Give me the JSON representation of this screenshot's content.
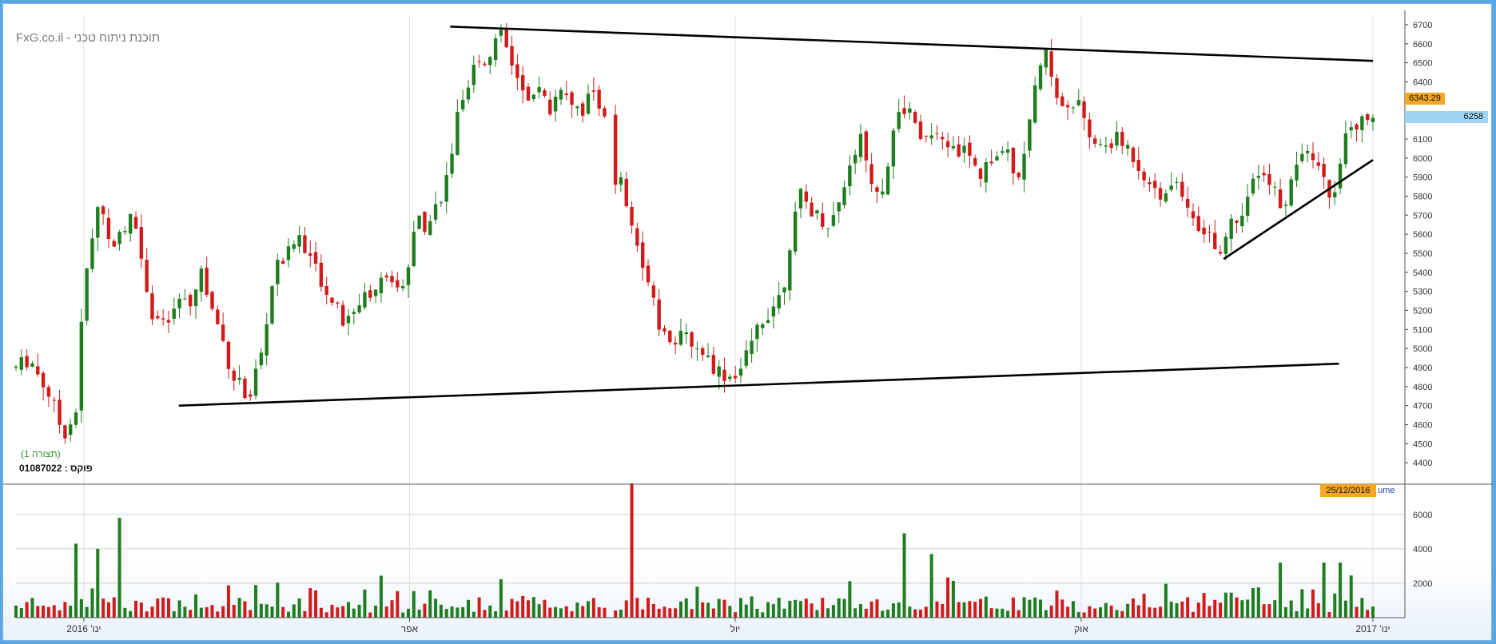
{
  "watermark": "FxG.co.il - תוכנת ניתוח טכני",
  "chart_caption": "(תצורה 1)",
  "focus_label": "פוקס : 01087022",
  "last_price_label": "6343.29",
  "current_price_label": "6258",
  "date_label": "25/12/2016",
  "volume_title": "ume",
  "colors": {
    "up": "#1e7d1e",
    "down": "#d21a1a",
    "grid": "#cfcfcf",
    "trendline": "#000000",
    "last_price_bg": "#f5a623",
    "current_price_bg": "#9fd4f5",
    "caption": "#2e8b2e"
  },
  "chart_data": [
    {
      "type": "candlestick",
      "title": "",
      "y_ticks": [
        4400,
        4500,
        4600,
        4700,
        4800,
        4900,
        5000,
        5100,
        5200,
        5300,
        5400,
        5500,
        5600,
        5700,
        5800,
        5900,
        6000,
        6100,
        6200,
        6300,
        6400,
        6500,
        6600,
        6700
      ],
      "ylim": [
        4300,
        6750
      ],
      "x_ticks": [
        "ינו' 2016",
        "אפר",
        "יול",
        "אוק",
        "ינו' 2017"
      ],
      "x_tick_positions": [
        0.05,
        0.29,
        0.53,
        0.785,
        1.0
      ],
      "trendlines": [
        {
          "name": "upper-resistance",
          "from": [
            0.32,
            6690
          ],
          "to": [
            1.0,
            6510
          ]
        },
        {
          "name": "lower-support",
          "from": [
            0.12,
            4700
          ],
          "to": [
            0.975,
            4920
          ]
        },
        {
          "name": "rising-support",
          "from": [
            0.89,
            5470
          ],
          "to": [
            1.0,
            5990
          ]
        }
      ],
      "anchors": [
        [
          0.0,
          4900
        ],
        [
          0.01,
          4950
        ],
        [
          0.025,
          4750
        ],
        [
          0.035,
          4550
        ],
        [
          0.045,
          4680
        ],
        [
          0.05,
          5350
        ],
        [
          0.055,
          5500
        ],
        [
          0.06,
          5750
        ],
        [
          0.065,
          5700
        ],
        [
          0.072,
          5500
        ],
        [
          0.08,
          5650
        ],
        [
          0.085,
          5750
        ],
        [
          0.092,
          5500
        ],
        [
          0.1,
          5200
        ],
        [
          0.11,
          5100
        ],
        [
          0.12,
          5250
        ],
        [
          0.13,
          5200
        ],
        [
          0.135,
          5450
        ],
        [
          0.142,
          5250
        ],
        [
          0.15,
          5100
        ],
        [
          0.16,
          4850
        ],
        [
          0.172,
          4750
        ],
        [
          0.182,
          5000
        ],
        [
          0.19,
          5400
        ],
        [
          0.2,
          5500
        ],
        [
          0.21,
          5600
        ],
        [
          0.218,
          5450
        ],
        [
          0.23,
          5300
        ],
        [
          0.24,
          5150
        ],
        [
          0.25,
          5200
        ],
        [
          0.26,
          5300
        ],
        [
          0.27,
          5350
        ],
        [
          0.28,
          5300
        ],
        [
          0.288,
          5400
        ],
        [
          0.295,
          5700
        ],
        [
          0.302,
          5650
        ],
        [
          0.31,
          5750
        ],
        [
          0.318,
          5900
        ],
        [
          0.325,
          6200
        ],
        [
          0.332,
          6300
        ],
        [
          0.34,
          6550
        ],
        [
          0.347,
          6500
        ],
        [
          0.355,
          6650
        ],
        [
          0.362,
          6600
        ],
        [
          0.37,
          6400
        ],
        [
          0.378,
          6250
        ],
        [
          0.386,
          6350
        ],
        [
          0.394,
          6250
        ],
        [
          0.402,
          6400
        ],
        [
          0.41,
          6300
        ],
        [
          0.418,
          6250
        ],
        [
          0.424,
          6350
        ],
        [
          0.43,
          6300
        ],
        [
          0.436,
          6200
        ],
        [
          0.44,
          5800
        ],
        [
          0.445,
          5900
        ],
        [
          0.452,
          5650
        ],
        [
          0.46,
          5500
        ],
        [
          0.468,
          5350
        ],
        [
          0.475,
          5100
        ],
        [
          0.485,
          5050
        ],
        [
          0.495,
          5050
        ],
        [
          0.505,
          5000
        ],
        [
          0.515,
          4900
        ],
        [
          0.525,
          4850
        ],
        [
          0.535,
          4900
        ],
        [
          0.545,
          5100
        ],
        [
          0.555,
          5200
        ],
        [
          0.565,
          5300
        ],
        [
          0.57,
          5550
        ],
        [
          0.578,
          5800
        ],
        [
          0.59,
          5700
        ],
        [
          0.6,
          5650
        ],
        [
          0.608,
          5800
        ],
        [
          0.615,
          6000
        ],
        [
          0.622,
          6100
        ],
        [
          0.63,
          5900
        ],
        [
          0.638,
          5800
        ],
        [
          0.648,
          6200
        ],
        [
          0.658,
          6250
        ],
        [
          0.665,
          6100
        ],
        [
          0.675,
          6100
        ],
        [
          0.69,
          6050
        ],
        [
          0.7,
          6050
        ],
        [
          0.71,
          5900
        ],
        [
          0.72,
          6000
        ],
        [
          0.73,
          6050
        ],
        [
          0.738,
          5900
        ],
        [
          0.745,
          6100
        ],
        [
          0.752,
          6400
        ],
        [
          0.76,
          6550
        ],
        [
          0.768,
          6300
        ],
        [
          0.775,
          6250
        ],
        [
          0.782,
          6300
        ],
        [
          0.79,
          6100
        ],
        [
          0.8,
          6050
        ],
        [
          0.81,
          6100
        ],
        [
          0.82,
          6050
        ],
        [
          0.828,
          5950
        ],
        [
          0.838,
          5850
        ],
        [
          0.846,
          5800
        ],
        [
          0.855,
          5900
        ],
        [
          0.865,
          5750
        ],
        [
          0.872,
          5650
        ],
        [
          0.88,
          5600
        ],
        [
          0.888,
          5520
        ],
        [
          0.895,
          5650
        ],
        [
          0.905,
          5750
        ],
        [
          0.915,
          5900
        ],
        [
          0.925,
          5850
        ],
        [
          0.933,
          5750
        ],
        [
          0.942,
          5900
        ],
        [
          0.95,
          6100
        ],
        [
          0.958,
          6000
        ],
        [
          0.965,
          5850
        ],
        [
          0.972,
          5800
        ],
        [
          0.978,
          6100
        ],
        [
          0.985,
          6150
        ],
        [
          0.993,
          6200
        ],
        [
          1.0,
          6250
        ]
      ]
    },
    {
      "type": "bar",
      "title": "Volume",
      "y_ticks": [
        2000,
        4000,
        6000
      ],
      "ylim": [
        0,
        7800
      ],
      "highlights": [
        [
          0.075,
          5800,
          "up"
        ],
        [
          0.045,
          4300,
          "up"
        ],
        [
          0.06,
          4000,
          "up"
        ],
        [
          0.452,
          8000,
          "down"
        ],
        [
          0.655,
          4900,
          "up"
        ],
        [
          0.675,
          3700,
          "up"
        ],
        [
          0.93,
          3200,
          "up"
        ],
        [
          0.965,
          3200,
          "up"
        ],
        [
          0.975,
          3200,
          "up"
        ]
      ]
    }
  ]
}
